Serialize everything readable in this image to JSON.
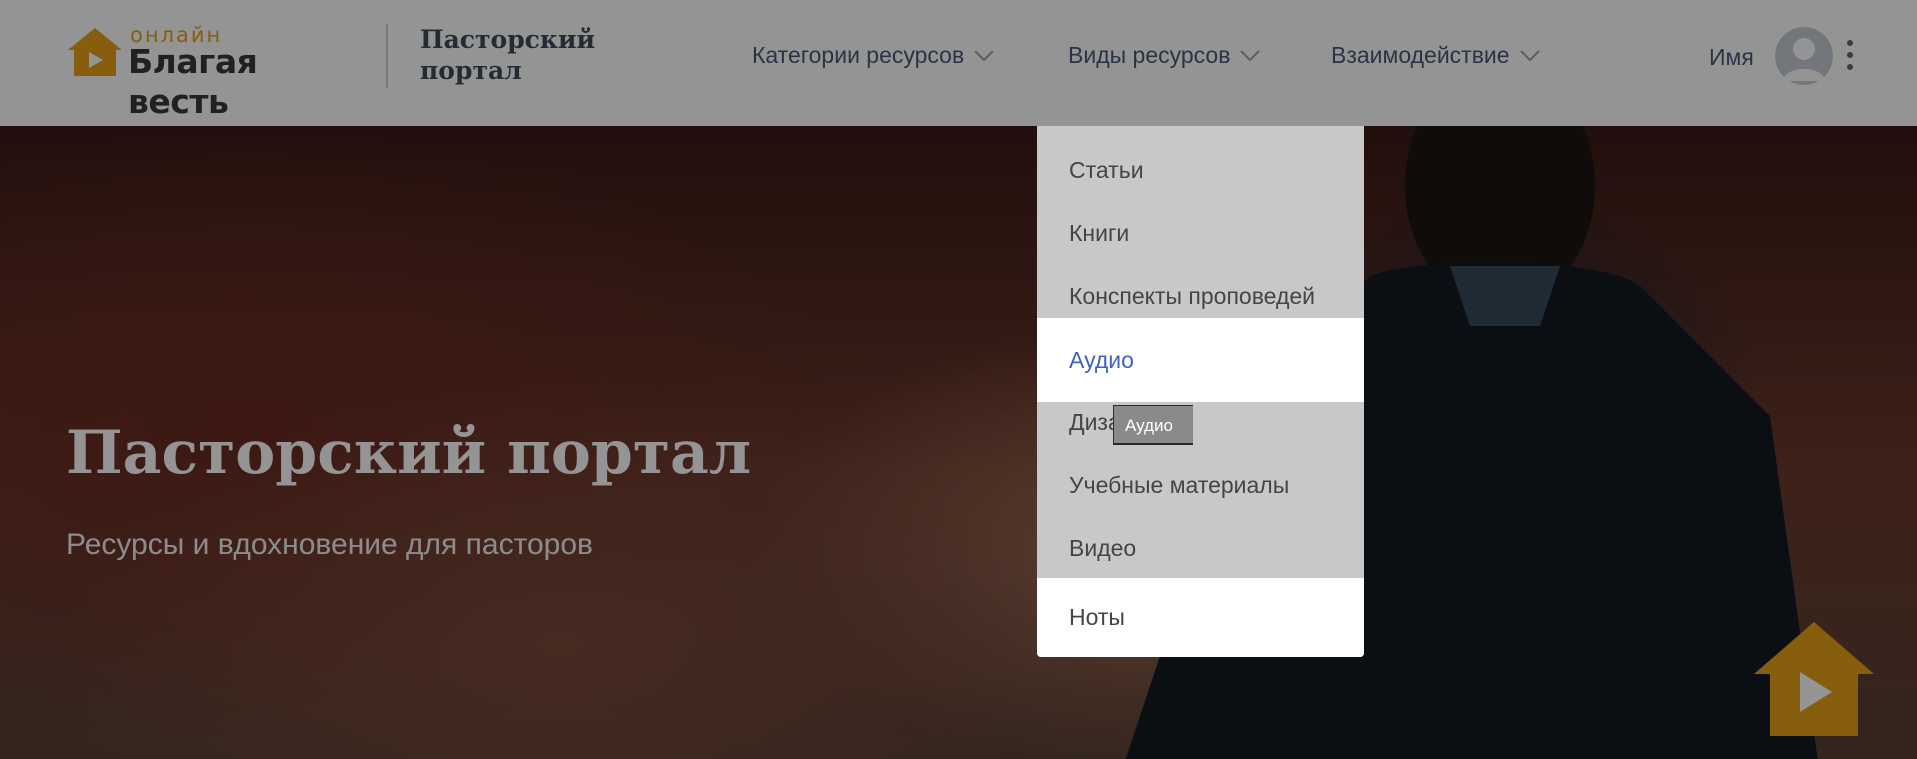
{
  "header": {
    "logo": {
      "small_text": "онлайн",
      "big_text": "Благая весть",
      "house_color": "#E8A317"
    },
    "portal_title_line1": "Пасторский",
    "portal_title_line2": "портал",
    "nav": [
      {
        "label": "Категории ресурсов",
        "icon": "chevron-down-icon"
      },
      {
        "label": "Виды ресурсов",
        "icon": "chevron-down-icon"
      },
      {
        "label": "Взаимодействие",
        "icon": "chevron-down-icon"
      }
    ],
    "user": {
      "name": "Имя",
      "avatar_icon": "user-avatar-icon",
      "menu_icon": "kebab-menu-icon"
    }
  },
  "hero": {
    "title": "Пасторский портал",
    "subtitle": "Ресурсы и вдохновение для пасторов"
  },
  "dropdown": {
    "items": [
      {
        "label": "Статьи",
        "highlighted": false
      },
      {
        "label": "Книги",
        "highlighted": false
      },
      {
        "label": "Конспекты проповедей",
        "highlighted": false
      },
      {
        "label": "Аудио",
        "highlighted": true,
        "active": true
      },
      {
        "label": "Дизайн",
        "highlighted": false
      },
      {
        "label": "Учебные материалы",
        "highlighted": false
      },
      {
        "label": "Видео",
        "highlighted": false
      },
      {
        "label": "Ноты",
        "highlighted": true
      }
    ],
    "tooltip": "Аудио",
    "active_color": "#3F63B8"
  },
  "fab": {
    "icon": "play-house-icon",
    "color": "#E8A317"
  }
}
